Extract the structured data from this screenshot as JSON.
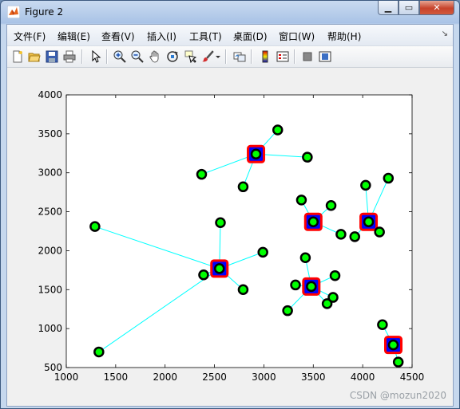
{
  "window": {
    "title": "Figure 2"
  },
  "menu": [
    "文件(F)",
    "编辑(E)",
    "查看(V)",
    "插入(I)",
    "工具(T)",
    "桌面(D)",
    "窗口(W)",
    "帮助(H)"
  ],
  "toolbar_icons": [
    "new-figure-icon",
    "open-file-icon",
    "save-icon",
    "print-icon",
    "select-arrow-icon",
    "zoom-in-icon",
    "zoom-out-icon",
    "pan-icon",
    "rotate-3d-icon",
    "data-cursor-icon",
    "brush-icon",
    "brush-dropdown-icon",
    "link-plot-icon",
    "colorbar-icon",
    "legend-icon",
    "hide-plot-tools-icon",
    "show-plot-tools-icon"
  ],
  "watermark": "CSDN @mozun2020",
  "colors": {
    "points": "#00ff00",
    "point_edge": "#000000",
    "centers": "#0000ff",
    "center_edge": "#ff0000",
    "lines": "#00ffff"
  },
  "chart_data": {
    "type": "scatter",
    "title": "",
    "xlabel": "",
    "ylabel": "",
    "xlim": [
      1000,
      4500
    ],
    "ylim": [
      500,
      4000
    ],
    "xticks": [
      1000,
      1500,
      2000,
      2500,
      3000,
      3500,
      4000,
      4500
    ],
    "yticks": [
      500,
      1000,
      1500,
      2000,
      2500,
      3000,
      3500,
      4000
    ],
    "grid": false,
    "clusters": [
      {
        "center": [
          2920,
          3240
        ],
        "points": [
          [
            2370,
            2980
          ],
          [
            2790,
            2820
          ],
          [
            3140,
            3550
          ],
          [
            3440,
            3200
          ],
          [
            2920,
            3240
          ]
        ]
      },
      {
        "center": [
          2550,
          1770
        ],
        "points": [
          [
            1290,
            2310
          ],
          [
            1330,
            700
          ],
          [
            2390,
            1690
          ],
          [
            2560,
            2360
          ],
          [
            2790,
            1500
          ],
          [
            2990,
            1980
          ],
          [
            2550,
            1770
          ]
        ]
      },
      {
        "center": [
          3500,
          2370
        ],
        "points": [
          [
            3380,
            2650
          ],
          [
            3680,
            2580
          ],
          [
            3780,
            2210
          ],
          [
            3500,
            2370
          ]
        ]
      },
      {
        "center": [
          3480,
          1540
        ],
        "points": [
          [
            3320,
            1560
          ],
          [
            3240,
            1230
          ],
          [
            3420,
            1910
          ],
          [
            3640,
            1320
          ],
          [
            3700,
            1400
          ],
          [
            3720,
            1680
          ],
          [
            3480,
            1540
          ]
        ]
      },
      {
        "center": [
          4060,
          2370
        ],
        "points": [
          [
            4030,
            2840
          ],
          [
            4260,
            2930
          ],
          [
            3920,
            2180
          ],
          [
            4170,
            2240
          ],
          [
            4060,
            2370
          ]
        ]
      },
      {
        "center": [
          4310,
          790
        ],
        "points": [
          [
            4200,
            1050
          ],
          [
            4360,
            570
          ],
          [
            4310,
            790
          ]
        ]
      }
    ]
  }
}
